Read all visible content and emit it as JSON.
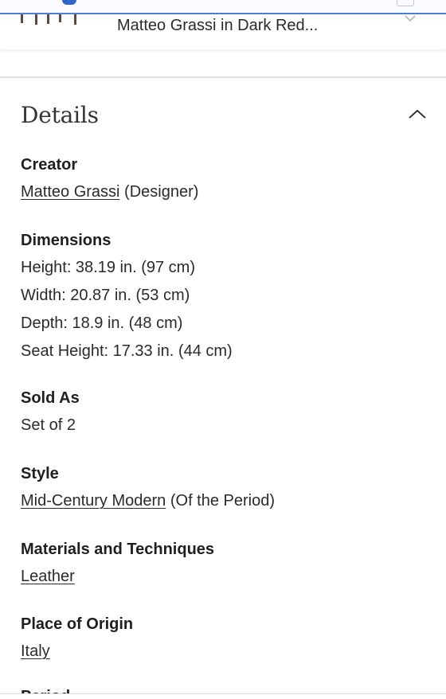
{
  "product_bar": {
    "title": "Matteo Grassi in Dark Red...",
    "thumbnail_icon": "chair-legs-thumbnail",
    "dropdown_icon": "chevron-down-icon"
  },
  "details": {
    "title": "Details",
    "toggle_icon": "chevron-up-icon",
    "creator": {
      "label": "Creator",
      "link": "Matteo Grassi",
      "suffix": " (Designer)"
    },
    "dimensions": {
      "label": "Dimensions",
      "items": [
        "Height: 38.19 in. (97 cm)",
        "Width: 20.87 in. (53 cm)",
        "Depth: 18.9 in. (48 cm)",
        "Seat Height: 17.33 in. (44 cm)"
      ]
    },
    "sold_as": {
      "label": "Sold As",
      "value": "Set of 2"
    },
    "style": {
      "label": "Style",
      "link": "Mid-Century Modern",
      "suffix": " (Of the Period)"
    },
    "materials": {
      "label": "Materials and Techniques",
      "link": "Leather"
    },
    "origin": {
      "label": "Place of Origin",
      "link": "Italy"
    },
    "period": {
      "label": "Period"
    }
  },
  "colors": {
    "browser_accent": "#4c7fd3",
    "divider": "#dedede",
    "text": "#222222"
  }
}
